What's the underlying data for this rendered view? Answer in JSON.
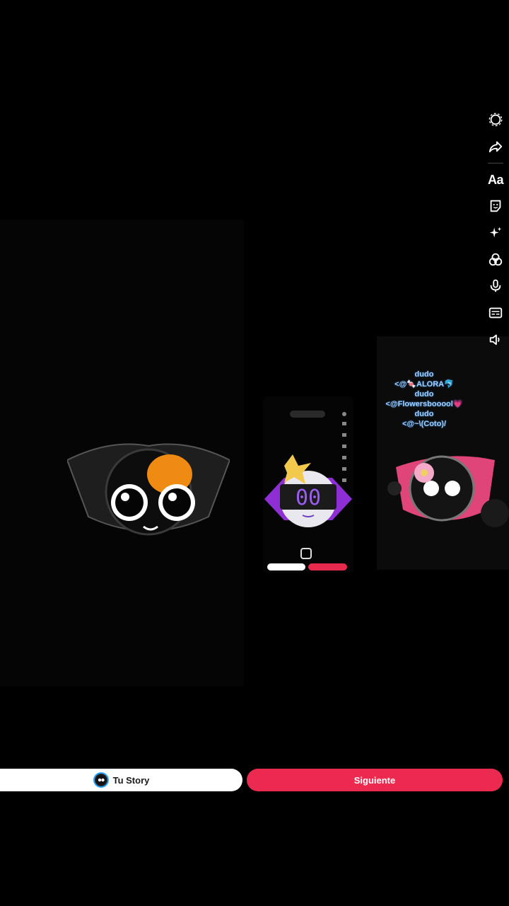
{
  "toolbar": {
    "items": [
      {
        "name": "settings-icon"
      },
      {
        "name": "share-icon"
      },
      {
        "name": "text-tool",
        "label": "Aa"
      },
      {
        "name": "sticker-icon"
      },
      {
        "name": "effects-icon"
      },
      {
        "name": "filters-icon"
      },
      {
        "name": "voice-icon"
      },
      {
        "name": "captions-icon"
      },
      {
        "name": "volume-icon"
      }
    ]
  },
  "overlay": {
    "tags": [
      "dudo",
      "<@🍬ALORA🐬",
      "dudo",
      "<@Flowersbooool💗",
      "dudo",
      "<@~\\(Coto)/"
    ]
  },
  "actions": {
    "story_label": "Tu Story",
    "next_label": "Siguiente"
  },
  "colors": {
    "accent": "#ec2a4f",
    "background": "#000000",
    "story_ring": "#2aa9ff"
  }
}
